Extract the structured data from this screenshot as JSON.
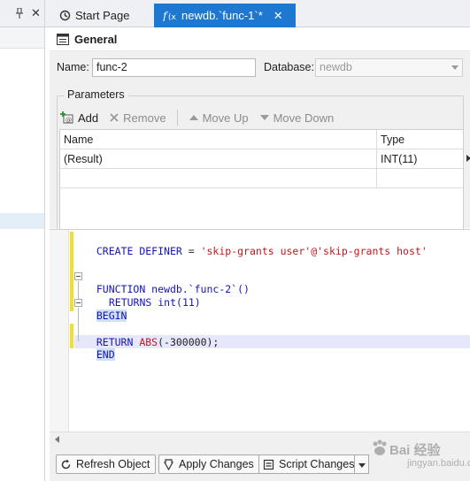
{
  "left_panel": {
    "pin_icon": "pin-icon",
    "close_icon": "close-icon"
  },
  "tabs": [
    {
      "label": "Start Page",
      "icon": "start-page-icon",
      "active": false
    },
    {
      "label": "newdb.`func-1`*",
      "icon": "function-icon",
      "active": true,
      "close": "✕"
    }
  ],
  "general": {
    "title": "General",
    "icon": "general-icon"
  },
  "form": {
    "name_label": "Name:",
    "name_value": "func-2",
    "database_label": "Database:",
    "database_value": "newdb"
  },
  "parameters": {
    "title": "Parameters",
    "toolbar": [
      {
        "label": "Add",
        "icon": "add-icon",
        "enabled": true
      },
      {
        "label": "Remove",
        "icon": "remove-icon",
        "enabled": false
      },
      {
        "label": "Move Up",
        "icon": "move-up-icon",
        "enabled": false
      },
      {
        "label": "Move Down",
        "icon": "move-down-icon",
        "enabled": false
      }
    ],
    "columns": [
      "Name",
      "Type"
    ],
    "rows": [
      [
        "(Result)",
        "INT(11)"
      ],
      [
        "",
        ""
      ]
    ]
  },
  "editor": {
    "lines": [
      {
        "kw1": "CREATE DEFINER",
        "op": " = ",
        "str": "'skip-grants user'@'skip-grants host'"
      },
      {
        "kw1": "FUNCTION",
        "rest": " newdb.`func-2`()"
      },
      {
        "kw1": "RETURNS",
        "rest": " int(11)"
      },
      {
        "kw1": "BEGIN"
      },
      {
        "kw1": ""
      },
      {
        "kw1": "RETURN",
        "fn": " ABS",
        "rest": "(-300000);"
      },
      {
        "kw1": "END"
      }
    ]
  },
  "buttons": {
    "refresh": "Refresh Object",
    "apply": "Apply Changes",
    "script": "Script Changes"
  },
  "watermark": {
    "main": "Bai 经验",
    "sub": "jingyan.baidu.com"
  },
  "colors": {
    "accent": "#1e78d0",
    "keyword": "#1414b8",
    "string": "#c4161c",
    "change_marker": "#f2df2a"
  }
}
